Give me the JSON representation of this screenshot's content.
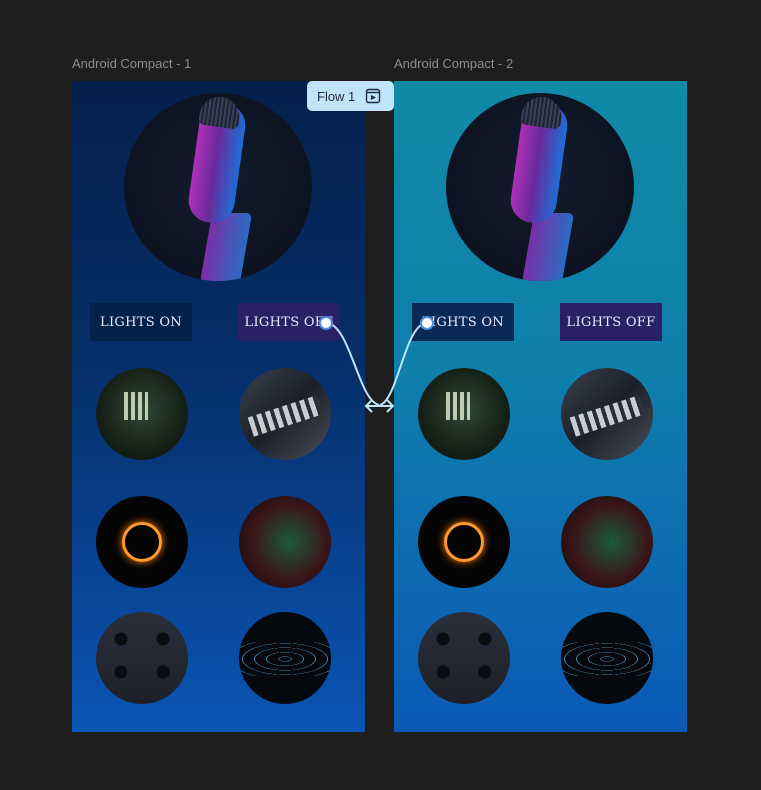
{
  "frames": [
    {
      "label": "Android Compact - 1",
      "buttons": {
        "on": "LIGHTS ON",
        "off": "LIGHTS OFF"
      }
    },
    {
      "label": "Android Compact - 2",
      "buttons": {
        "on": "LIGHTS ON",
        "off": "LIGHTS OFF"
      }
    }
  ],
  "flow": {
    "label": "Flow 1",
    "icon": "flow-start-icon"
  },
  "colors": {
    "canvas": "#1e1e1e",
    "frame1_top": "#03204a",
    "frame1_bottom": "#0a55b5",
    "frame2_top": "#108aa5",
    "frame2_bottom": "#0a59b6",
    "connector": "#bfe3f7"
  },
  "images": {
    "hero": "microphone-image",
    "thumbnails": [
      "house-lights-image",
      "console-image",
      "light-ring-image",
      "particles-image",
      "knobs-image",
      "wave-image"
    ]
  }
}
